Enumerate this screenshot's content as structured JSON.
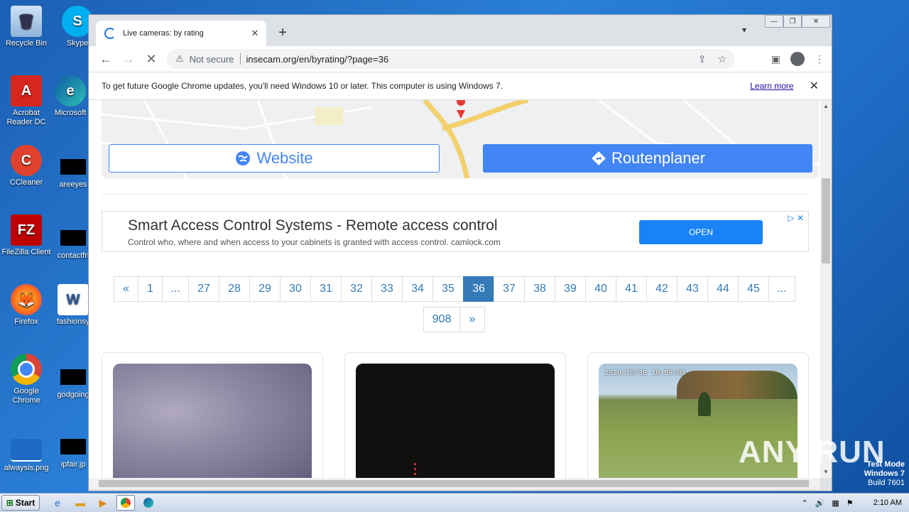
{
  "desktop": {
    "icons": [
      {
        "label": "Recycle Bin"
      },
      {
        "label": "Skype"
      },
      {
        "label": "Acrobat Reader DC"
      },
      {
        "label": "Microsoft"
      },
      {
        "label": "CCleaner"
      },
      {
        "label": "areeyes"
      },
      {
        "label": "FileZilla Client"
      },
      {
        "label": "contactfri"
      },
      {
        "label": "Firefox"
      },
      {
        "label": "fashionsy"
      },
      {
        "label": "Google Chrome"
      },
      {
        "label": "godgoing"
      },
      {
        "label": "alwaysis.png"
      },
      {
        "label": "ipfair.jp"
      }
    ]
  },
  "browser": {
    "tab": {
      "title": "Live cameras: by rating",
      "close": "✕"
    },
    "new_tab": "+",
    "window_controls": {
      "minimize": "—",
      "maximize": "❐",
      "close": "✕"
    },
    "address": {
      "security": "Not secure",
      "url": "insecam.org/en/byrating/?page=36"
    },
    "infobar": {
      "message": "To get future Google Chrome updates, you'll need Windows 10 or later. This computer is using Windows 7.",
      "link": "Learn more",
      "close": "✕"
    }
  },
  "page": {
    "map_buttons": {
      "website": "Website",
      "route": "Routenplaner"
    },
    "ad": {
      "headline": "Smart Access Control Systems - Remote access control",
      "description": "Control who, where and when access to your cabinets is granted with access control. camlock.com",
      "cta": "OPEN"
    },
    "pagination": {
      "row1": [
        "«",
        "1",
        "...",
        "27",
        "28",
        "29",
        "30",
        "31",
        "32",
        "33",
        "34",
        "35",
        "36",
        "37",
        "38",
        "39",
        "40",
        "41",
        "42",
        "43",
        "44",
        "45",
        "..."
      ],
      "row2": [
        "908",
        "»"
      ],
      "active": "36"
    },
    "cameras": [
      {
        "timestamp": ""
      },
      {
        "timestamp": ""
      },
      {
        "timestamp": "2020/10/30  10:59:02"
      }
    ]
  },
  "overlay": {
    "watermark": "ANY RUN",
    "test_mode": "Test Mode",
    "os": "Windows 7",
    "build": "Build 7601"
  },
  "taskbar": {
    "start": "Start",
    "clock": "2:10 AM"
  },
  "colors": {
    "accent": "#4285f4",
    "page_link": "#337ab7",
    "ad_button": "#1a82f7"
  }
}
